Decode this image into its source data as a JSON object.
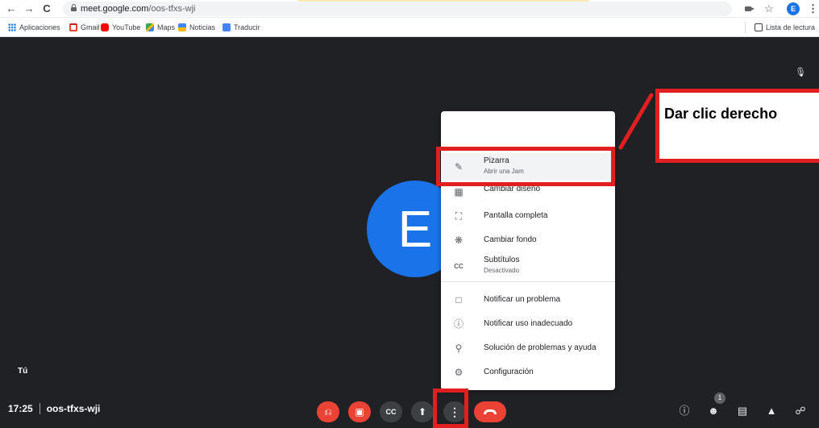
{
  "browser": {
    "url_host": "meet.google.com",
    "url_path": "/oos-tfxs-wji",
    "profile_initial": "E",
    "icons": [
      "back-arrow-icon",
      "forward-arrow-icon",
      "reload-icon",
      "lock-icon",
      "camera-icon",
      "star-icon",
      "kebab-icon"
    ]
  },
  "bookmarks": {
    "items": [
      {
        "label": "Aplicaciones",
        "icon": "apps-grid-icon",
        "color": "#1a73e8"
      },
      {
        "label": "Gmail",
        "icon": "gmail-icon",
        "color": "#ea4335"
      },
      {
        "label": "YouTube",
        "icon": "youtube-icon",
        "color": "#ff0000"
      },
      {
        "label": "Maps",
        "icon": "maps-icon",
        "color": "#34a853"
      },
      {
        "label": "Noticias",
        "icon": "news-icon",
        "color": "#4285f4"
      },
      {
        "label": "Traducir",
        "icon": "translate-icon",
        "color": "#4285f4"
      }
    ],
    "reading_list": "Lista de lectura"
  },
  "meeting": {
    "participant_initial": "E",
    "self_label": "Tú",
    "time": "17:25",
    "code": "oos-tfxs-wji",
    "participant_count": "1",
    "avatar_color": "#1a73e8"
  },
  "menu": {
    "items": [
      {
        "label": "Pizarra",
        "sub": "Abrir una Jam",
        "icon": "pen-icon"
      },
      {
        "label": "Cambiar diseño",
        "icon": "layout-icon"
      },
      {
        "label": "Pantalla completa",
        "icon": "fullscreen-icon"
      },
      {
        "label": "Cambiar fondo",
        "icon": "background-icon"
      },
      {
        "label": "Subtítulos",
        "sub": "Desactivado",
        "icon": "captions-icon"
      },
      {
        "label": "Notificar un problema",
        "icon": "feedback-icon"
      },
      {
        "label": "Notificar uso inadecuado",
        "icon": "report-icon"
      },
      {
        "label": "Solución de problemas y ayuda",
        "icon": "troubleshoot-icon"
      },
      {
        "label": "Configuración",
        "icon": "settings-icon"
      }
    ]
  },
  "annotation": {
    "callout_text": "Dar clic derecho",
    "accent": "#e02020"
  }
}
